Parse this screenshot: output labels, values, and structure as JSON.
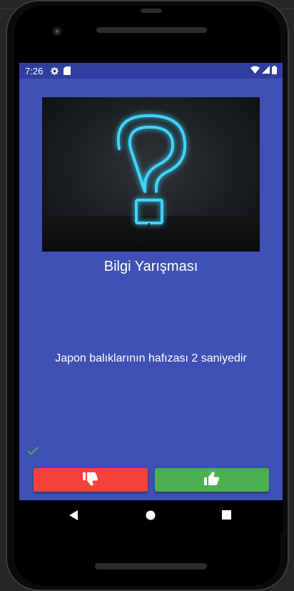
{
  "status_bar": {
    "time": "7:26",
    "icons": [
      "gear-icon",
      "sd-card-icon",
      "wifi-icon",
      "signal-icon",
      "battery-icon"
    ]
  },
  "app": {
    "title": "Bilgi Yarışması",
    "question": "Japon balıklarının hafızası 2 saniyedir",
    "hero_image": "neon-question-mark-image",
    "feedback_icon": "check-icon",
    "buttons": {
      "false_icon": "thumbs-down-icon",
      "true_icon": "thumbs-up-icon"
    }
  },
  "nav": {
    "icons": [
      "back-icon",
      "home-icon",
      "recents-icon"
    ]
  },
  "colors": {
    "primary": "#3f51b5",
    "primary_dark": "#303f9f",
    "false_button": "#f44336",
    "true_button": "#4caf50",
    "neon": "#3fd4ff"
  }
}
